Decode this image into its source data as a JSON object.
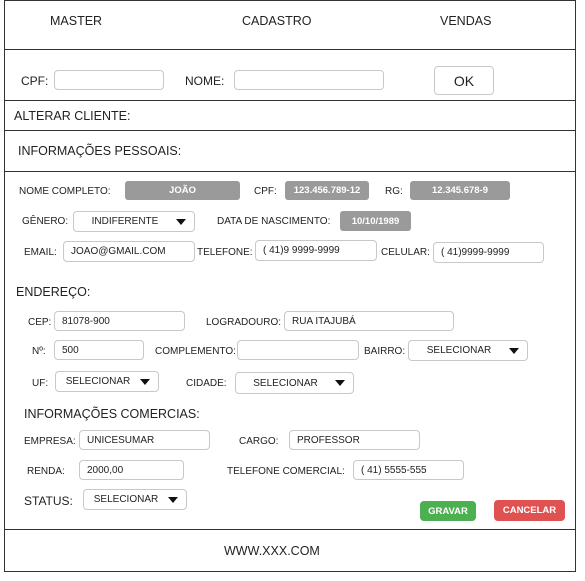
{
  "nav": {
    "master": "MASTER",
    "cadastro": "CADASTRO",
    "vendas": "VENDAS"
  },
  "search": {
    "cpf_label": "CPF:",
    "cpf_value": "",
    "nome_label": "NOME:",
    "nome_value": "",
    "ok_label": "OK"
  },
  "alterar_cliente": "ALTERAR CLIENTE:",
  "info_pessoais": "INFORMAÇÕES PESSOAIS:",
  "personal": {
    "nome_label": "NOME COMPLETO:",
    "nome_value": "JOÃO",
    "cpf_label": "CPF:",
    "cpf_value": "123.456.789-12",
    "rg_label": "RG:",
    "rg_value": "12.345.678-9",
    "genero_label": "GÊNERO:",
    "genero_value": "INDIFERENTE",
    "nascimento_label": "DATA DE NASCIMENTO:",
    "nascimento_value": "10/10/1989",
    "email_label": "EMAIL:",
    "email_value": "JOAO@GMAIL.COM",
    "telefone_label": "TELEFONE:",
    "telefone_value": "( 41)9 9999-9999",
    "celular_label": "CELULAR:",
    "celular_value": "( 41)9999-9999"
  },
  "endereco": {
    "title": "ENDEREÇO:",
    "cep_label": "CEP:",
    "cep_value": "81078-900",
    "logradouro_label": "LOGRADOURO:",
    "logradouro_value": "RUA ITAJUBÁ",
    "numero_label": "Nº:",
    "numero_value": "500",
    "complemento_label": "COMPLEMENTO:",
    "complemento_value": "",
    "bairro_label": "BAIRRO:",
    "bairro_value": "SELECIONAR",
    "uf_label": "UF:",
    "uf_value": "SELECIONAR",
    "cidade_label": "CIDADE:",
    "cidade_value": "SELECIONAR"
  },
  "comercial": {
    "title": "INFORMAÇÕES COMERCIAS:",
    "empresa_label": "EMPRESA:",
    "empresa_value": "UNICESUMAR",
    "cargo_label": "CARGO:",
    "cargo_value": "PROFESSOR",
    "renda_label": "RENDA:",
    "renda_value": "2000,00",
    "tel_comercial_label": "TELEFONE COMERCIAL:",
    "tel_comercial_value": "( 41) 5555-555",
    "status_label": "STATUS:",
    "status_value": "SELECIONAR"
  },
  "actions": {
    "gravar": "GRAVAR",
    "cancelar": "CANCELAR"
  },
  "footer": "WWW.XXX.COM",
  "colors": {
    "gravar": "#4caf50",
    "cancelar": "#e05252",
    "pill": "#9a9a9a",
    "border": "#333333"
  }
}
